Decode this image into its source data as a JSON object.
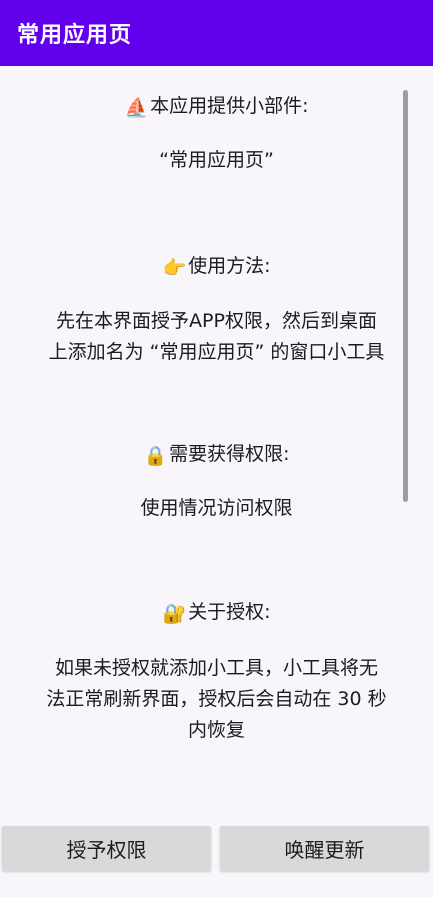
{
  "app_bar": {
    "title": "常用应用页"
  },
  "content": {
    "widget_heading": {
      "emoji": "⛵",
      "text": "本应用提供小部件:"
    },
    "widget_name": "“常用应用页”",
    "usage_heading": {
      "emoji": "👉",
      "text": "使用方法:"
    },
    "usage_line1": "先在本界面授予APP权限，然后到桌面",
    "usage_line2": "上添加名为 “常用应用页” 的窗口小工具",
    "permission_heading": {
      "emoji": "🔒",
      "text": "需要获得权限:"
    },
    "permission_text": "使用情况访问权限",
    "auth_heading": {
      "emoji": "🔐",
      "text": "关于授权:"
    },
    "auth_line1": "如果未授权就添加小工具，小工具将无",
    "auth_line2": "法正常刷新界面，授权后会自动在 30 秒",
    "auth_line3": "内恢复"
  },
  "buttons": {
    "grant_label": "授予权限",
    "refresh_label": "唤醒更新"
  }
}
